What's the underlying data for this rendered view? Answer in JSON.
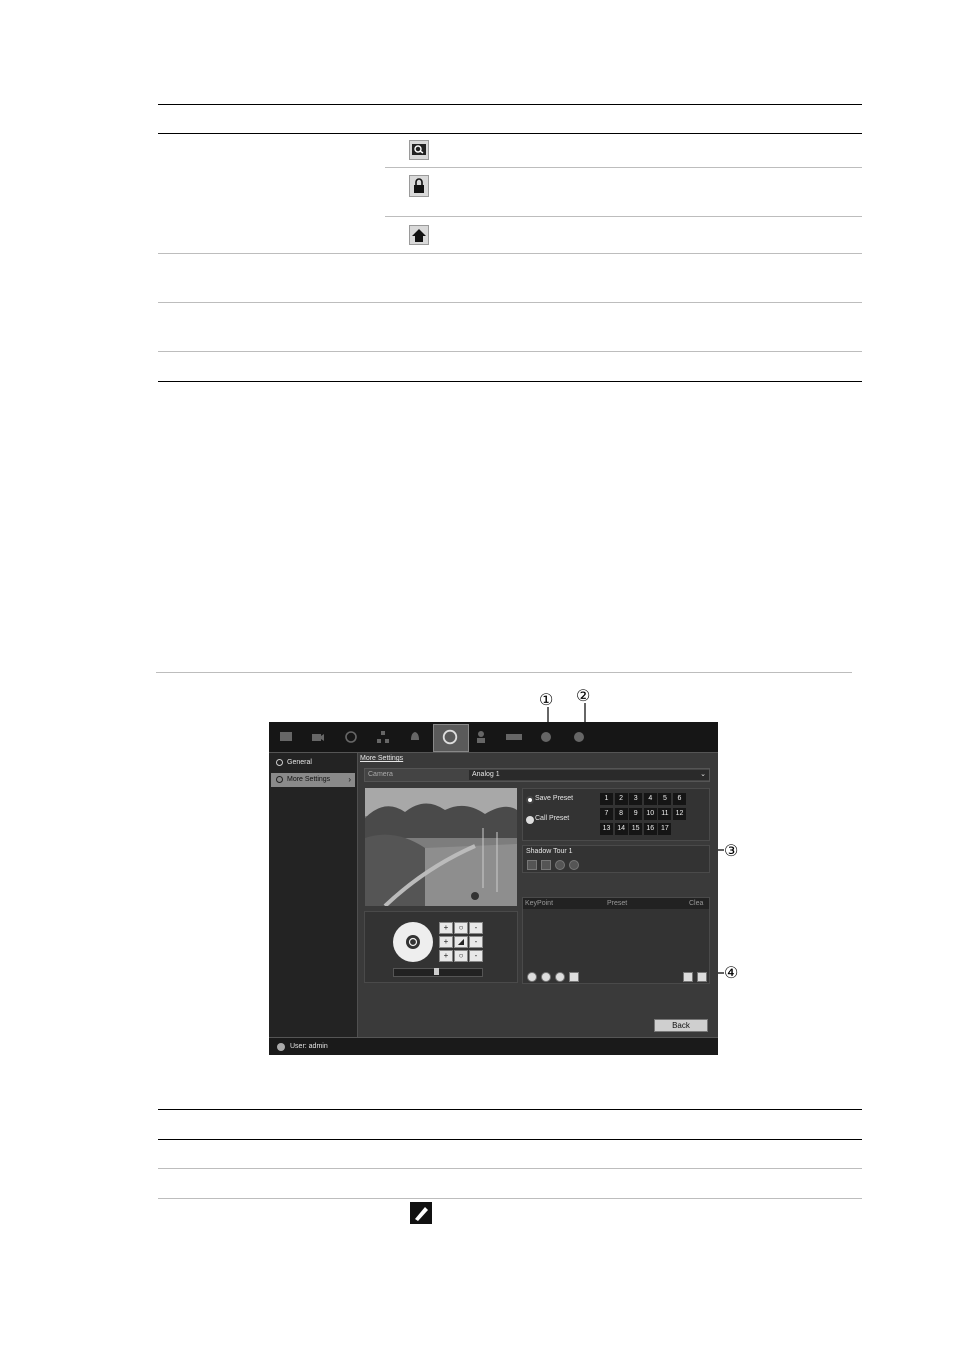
{
  "screenshot": {
    "sidebar": {
      "items": [
        {
          "label": "General"
        },
        {
          "label": "More Settings"
        }
      ]
    },
    "tab_title": "More Settings",
    "camera": {
      "label": "Camera",
      "value": "Analog 1"
    },
    "preset_mode": {
      "save_label": "Save Preset",
      "call_label": "Call Preset"
    },
    "preset_numbers": [
      "1",
      "2",
      "3",
      "4",
      "5",
      "6",
      "7",
      "8",
      "9",
      "10",
      "11",
      "12",
      "13",
      "14",
      "15",
      "16",
      "17"
    ],
    "shadow_tour": "Shadow Tour 1",
    "table_headers": [
      "KeyPoint",
      "Preset",
      "Clea"
    ],
    "back_label": "Back",
    "user_label": "User: admin"
  },
  "callouts": [
    "①",
    "②",
    "③",
    "④"
  ],
  "icons": [
    "zoom-icon",
    "lock-icon",
    "home-icon",
    "pen-icon"
  ]
}
